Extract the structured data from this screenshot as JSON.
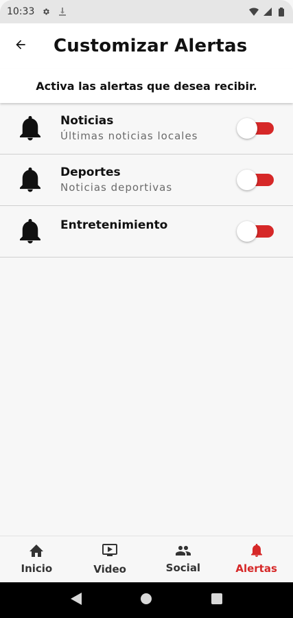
{
  "status_bar": {
    "time": "10:33",
    "icons": [
      "gear-icon",
      "download-icon",
      "wifi-icon",
      "signal-icon",
      "battery-icon"
    ]
  },
  "app_bar": {
    "back_icon": "arrow-left-icon",
    "title": "Customizar Alertas"
  },
  "subtitle": "Activa las alertas que desea recibir.",
  "alerts": [
    {
      "title": "Noticias",
      "subtitle": "Últimas noticias locales",
      "icon": "bell-icon",
      "enabled": true
    },
    {
      "title": "Deportes",
      "subtitle": "Noticias deportivas",
      "icon": "bell-icon",
      "enabled": true
    },
    {
      "title": "Entretenimiento",
      "subtitle": "",
      "icon": "bell-icon",
      "enabled": true
    }
  ],
  "bottom_nav": {
    "active_index": 3,
    "items": [
      {
        "label": "Inicio",
        "icon": "home-icon"
      },
      {
        "label": "Video",
        "icon": "video-icon"
      },
      {
        "label": "Social",
        "icon": "people-icon"
      },
      {
        "label": "Alertas",
        "icon": "bell-icon"
      }
    ]
  },
  "colors": {
    "accent": "#d62828",
    "background": "#f7f7f7",
    "text": "#111111",
    "muted": "#6a6a6a"
  }
}
